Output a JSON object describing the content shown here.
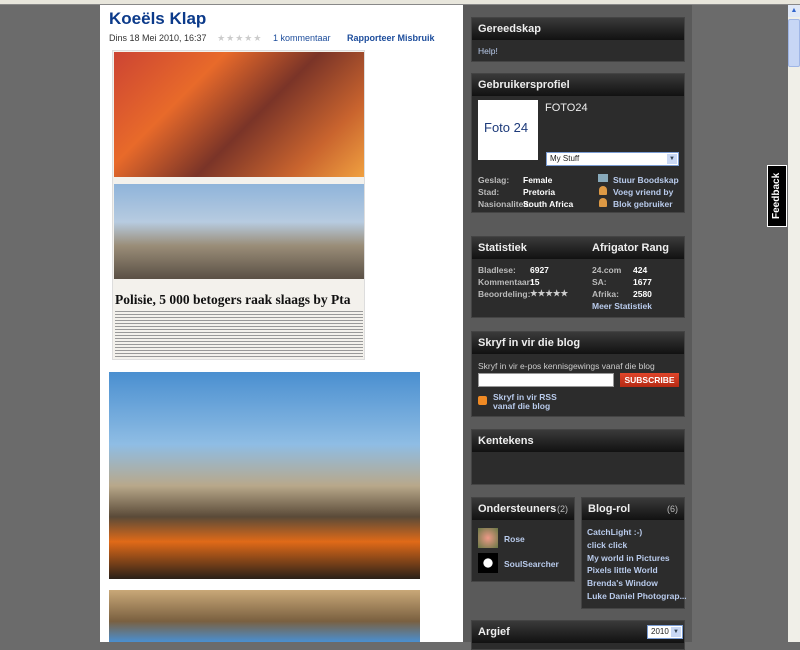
{
  "post": {
    "title": "Koeëls Klap",
    "date": "Dins 18 Mei 2010, 16:37",
    "rating_stars": "★★★★★",
    "comments": "1 kommentaar",
    "report": "Rapporteer Misbruik",
    "headline": "Polisie, 5 000 betogers raak slaags by Pta"
  },
  "tools": {
    "title": "Gereedskap",
    "help": "Help!"
  },
  "profile": {
    "title": "Gebruikersprofiel",
    "name": "FOTO24",
    "logo_text": "Foto 24",
    "dropdown": "My Stuff",
    "fields": [
      {
        "label": "Geslag:",
        "value": "Female"
      },
      {
        "label": "Stad:",
        "value": "Pretoria"
      },
      {
        "label": "Nasionaliteit:",
        "value": "South Africa"
      }
    ],
    "actions": [
      "Stuur Boodskap",
      "Voeg vriend by",
      "Blok gebruiker"
    ]
  },
  "stats": {
    "title": "Statistiek",
    "rank_title": "Afrigator Rang",
    "rows": [
      {
        "label": "Bladlese:",
        "value": "6927"
      },
      {
        "label": "Kommentaar:",
        "value": "15"
      },
      {
        "label": "Beoordeling:",
        "value": "★★★★★"
      }
    ],
    "rank": [
      {
        "label": "24.com",
        "value": "424"
      },
      {
        "label": "SA:",
        "value": "1677"
      },
      {
        "label": "Afrika:",
        "value": "2580"
      }
    ],
    "more": "Meer Statistiek"
  },
  "subscribe": {
    "title": "Skryf in vir die blog",
    "desc": "Skryf in vir e-pos kennisgewings vanaf die blog",
    "email_value": "",
    "button": "SUBSCRIBE",
    "rss_line1": "Skryf in vir RSS",
    "rss_line2": "vanaf die blog"
  },
  "badges": {
    "title": "Kentekens"
  },
  "supporters": {
    "title": "Ondersteuners",
    "count": "(2)",
    "items": [
      "Rose",
      "SoulSearcher"
    ]
  },
  "blogroll": {
    "title": "Blog-rol",
    "count": "(6)",
    "items": [
      "CatchLight :-)",
      "click click",
      "My world in Pictures",
      "Pixels little World",
      "Brenda's Window",
      "Luke Daniel Photograp..."
    ]
  },
  "archive": {
    "title": "Argief",
    "year": "2010"
  },
  "feedback": "Feedback"
}
